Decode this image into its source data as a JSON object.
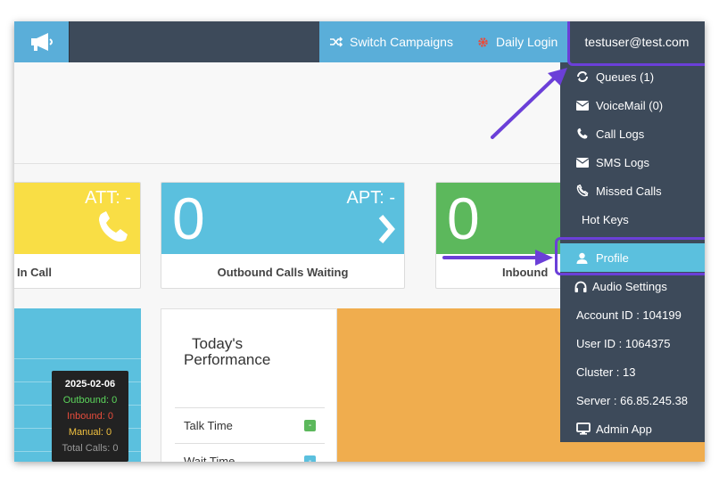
{
  "topbar": {
    "logo_icon": "megaphone-icon",
    "nav": [
      {
        "label": "Switch Campaigns",
        "icon": "shuffle-icon"
      },
      {
        "label": "Daily Login",
        "icon": "gear-icon"
      }
    ],
    "user": "testuser@test.com"
  },
  "cards": [
    {
      "label": "In Call",
      "tag": "ATT: -",
      "color": "#f9de45",
      "icon": "phone-icon"
    },
    {
      "value": "0",
      "label": "Outbound Calls Waiting",
      "tag": "APT: -",
      "color": "#5bc0de",
      "icon": "chevron-right-icon"
    },
    {
      "value": "0",
      "label": "Inbound",
      "color": "#5cb85c"
    }
  ],
  "tooltip": {
    "date": "2025-02-06",
    "outbound": "Outbound: 0",
    "inbound": "Inbound: 0",
    "manual": "Manual: 0",
    "total": "Total Calls: 0"
  },
  "performance": {
    "title_line1": "Today's",
    "title_line2": "Performance",
    "rows": [
      {
        "label": "Talk Time",
        "badge": "-",
        "color": "#5cb85c"
      },
      {
        "label": "Wait Time",
        "badge": "-",
        "color": "#5bc0de"
      }
    ]
  },
  "dropdown": {
    "items": [
      {
        "label": "Queues (1)",
        "icon": "refresh-icon"
      },
      {
        "label": "VoiceMail (0)",
        "icon": "envelope-icon"
      },
      {
        "label": "Call Logs",
        "icon": "phone-icon"
      },
      {
        "label": "SMS Logs",
        "icon": "envelope-icon"
      },
      {
        "label": "Missed Calls",
        "icon": "phone-slash-icon"
      },
      {
        "label": "Hot Keys",
        "icon": ""
      },
      {
        "label": "Profile",
        "icon": "user-icon"
      },
      {
        "label": "Audio Settings",
        "icon": "headphones-icon"
      },
      {
        "label": "Account ID : 104199",
        "icon": ""
      },
      {
        "label": "User ID : 1064375",
        "icon": ""
      },
      {
        "label": "Cluster : 13",
        "icon": ""
      },
      {
        "label": "Server : 66.85.245.38",
        "icon": ""
      },
      {
        "label": "Admin App",
        "icon": "monitor-icon"
      }
    ]
  },
  "colors": {
    "highlight": "#6b3fd8",
    "navbar": "#3d4a5a",
    "nav_blue": "#5aaed9",
    "profile_active": "#5bc0de"
  }
}
